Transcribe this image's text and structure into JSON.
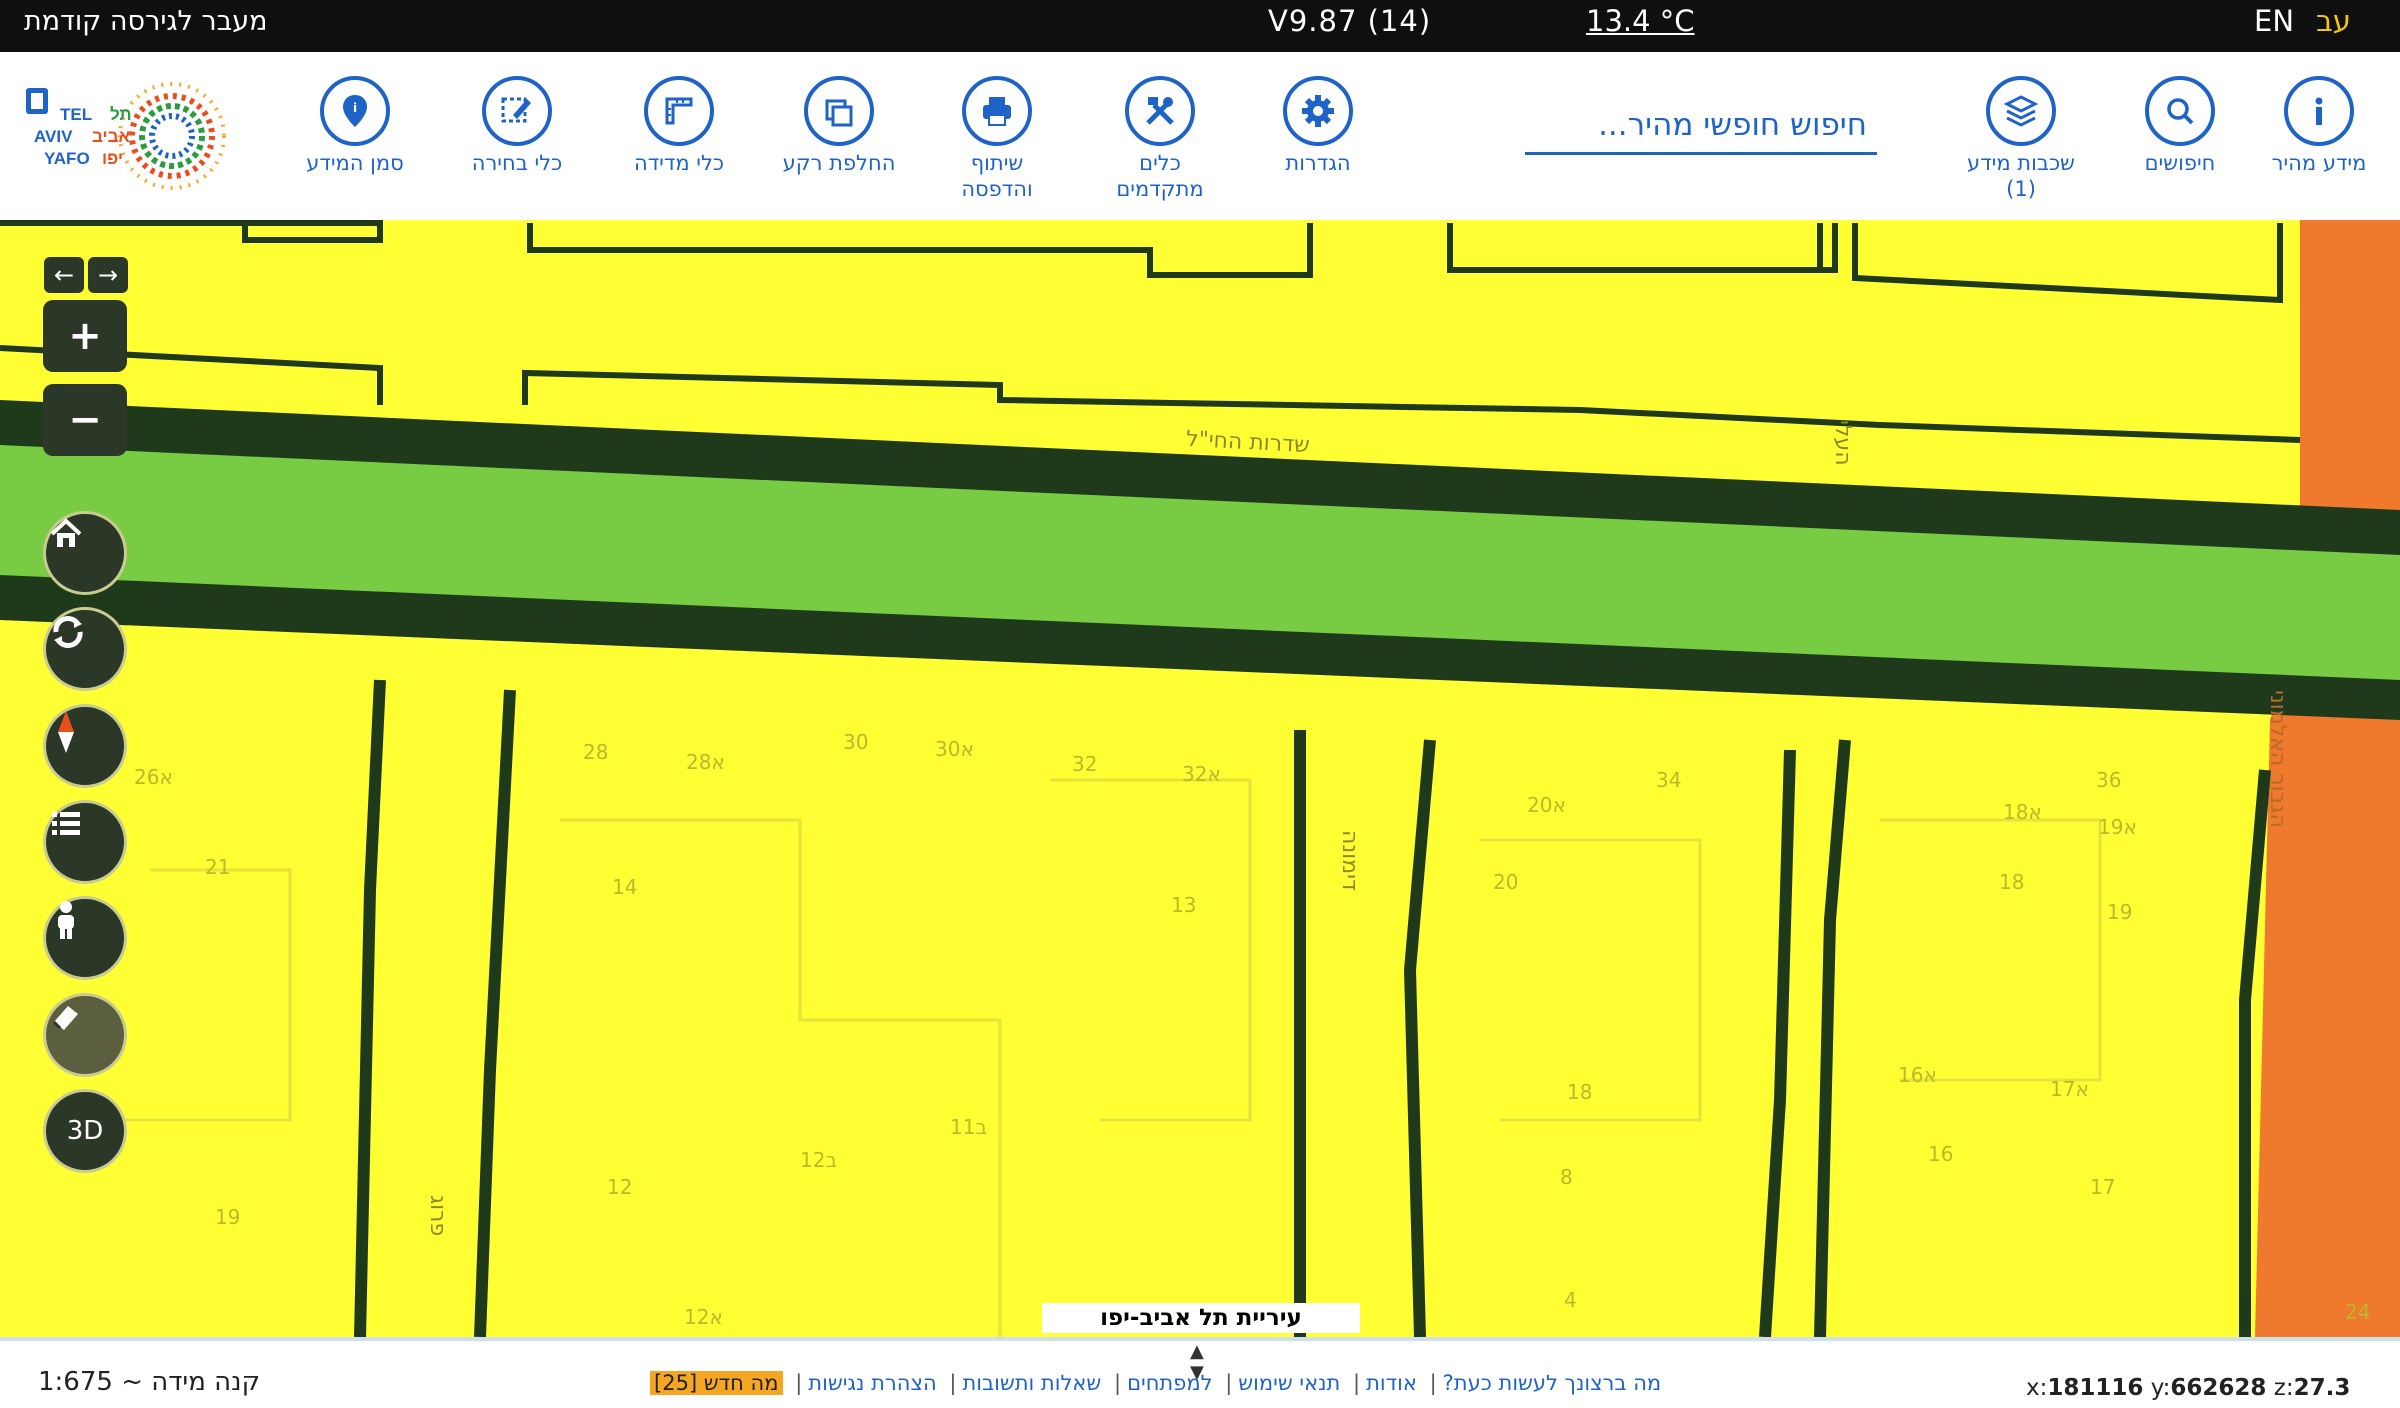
{
  "topbar": {
    "previous_version": "מעבר לגירסה קודמת",
    "version": "V9.87 (14)",
    "temperature": "13.4 °C",
    "lang_en": "EN",
    "lang_he": "עב"
  },
  "toolbar": {
    "tools": [
      {
        "label": "סמן המידע",
        "icon": "map-pin-icon"
      },
      {
        "label": "כלי בחירה",
        "icon": "pencil-select-icon"
      },
      {
        "label": "כלי מדידה",
        "icon": "ruler-icon"
      },
      {
        "label": "החלפת רקע",
        "icon": "layers-square-icon"
      },
      {
        "label": "שיתוף\nוהדפסה",
        "icon": "printer-icon"
      },
      {
        "label": "כלים\nמתקדמים",
        "icon": "tools-icon"
      },
      {
        "label": "הגדרות",
        "icon": "gear-icon"
      },
      {
        "label": "שכבות מידע\n(1)",
        "icon": "stack-icon"
      },
      {
        "label": "חיפושים",
        "icon": "search-icon"
      },
      {
        "label": "מידע מהיר",
        "icon": "info-icon"
      }
    ],
    "search_placeholder": "חיפוש חופשי מהיר...",
    "logo_text": [
      "TEL",
      "AVIV",
      "YAFO",
      "תל",
      "אביב",
      "יפו"
    ]
  },
  "map": {
    "city_label": "עיריית תל אביב-יפו",
    "street_labels": [
      "שדרות החי\"ל",
      "הגבור האלמוני",
      "דימונה",
      "פרוג",
      "העלי"
    ],
    "parcel_labels": [
      "26א",
      "21",
      "19",
      "28",
      "28א",
      "14",
      "12",
      "30",
      "30א",
      "32",
      "32א",
      "13",
      "11ב",
      "12ב",
      "12א",
      "20א",
      "34",
      "20",
      "18",
      "8",
      "4",
      "18א",
      "36",
      "19א",
      "18",
      "19",
      "16א",
      "17א",
      "16",
      "17",
      "24"
    ],
    "colors": {
      "residential": "#ffff33",
      "park": "#78cc44",
      "road": "#1f3a1a",
      "commercial": "#ef7a2e"
    },
    "controls": {
      "three_d": "3D"
    }
  },
  "bottombar": {
    "scale_label": "קנה מידה ~ 1:675",
    "links": [
      "מה ברצונך לעשות כעת?",
      "אודות",
      "תנאי שימוש",
      "למפתחים",
      "שאלות ותשובות",
      "הצהרת נגישות"
    ],
    "news": "מה חדש [25]",
    "coords": {
      "x": "181116",
      "y": "662628",
      "z": "27.3"
    }
  }
}
